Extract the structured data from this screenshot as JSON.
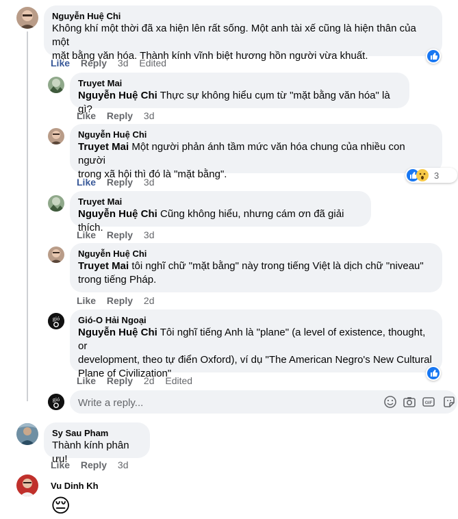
{
  "comments": [
    {
      "author": "Nguyễn Huệ Chi",
      "line1": "Không khí một thời đã xa hiện lên rất sống. Một anh tài xế cũng là hiện thân của một",
      "line2": "mặt bằng văn hóa. Thành kính vĩnh biệt hương hồn người vừa khuất.",
      "like": "Like",
      "reply": "Reply",
      "time": "3d",
      "edited": "Edited",
      "replies": [
        {
          "author": "Truyet Mai",
          "tag": "Nguyễn Huệ Chi",
          "text": " Thực sự không hiểu cụm từ \"mặt bằng văn hóa\" là gì?",
          "like": "Like",
          "reply": "Reply",
          "time": "3d"
        },
        {
          "author": "Nguyễn Huệ Chi",
          "tag": "Truyet Mai",
          "text": " Một người phản ánh tầm mức văn hóa chung của nhiều con người",
          "text2": "trong xã hội thì đó là \"mặt bằng\".",
          "like": "Like",
          "reply": "Reply",
          "time": "3d",
          "reaction_count": "3"
        },
        {
          "author": "Truyet Mai",
          "tag": "Nguyễn Huệ Chi",
          "text": " Cũng không hiểu, nhưng cám ơn đã giải thích.",
          "like": "Like",
          "reply": "Reply",
          "time": "3d"
        },
        {
          "author": "Nguyễn Huệ Chi",
          "tag": "Truyet Mai",
          "text": " tôi nghĩ chữ \"mặt bằng\" này trong tiếng Việt là dịch chữ \"niveau\"",
          "text2": "trong tiếng Pháp.",
          "like": "Like",
          "reply": "Reply",
          "time": "2d"
        },
        {
          "author": "Gió-O Hải Ngoại",
          "tag": "Nguyễn Huệ Chi",
          "text": " Tôi nghĩ tiếng Anh là \"plane\" (a level of existence, thought, or",
          "text2": "development, theo tự điển Oxford), ví dụ \"The American Negro's New Cultural",
          "text3": "Plane of Civilization\"",
          "like": "Like",
          "reply": "Reply",
          "time": "2d",
          "edited": "Edited"
        }
      ]
    },
    {
      "author": "Sy Sau Pham",
      "line1": "Thành kính phân ưu!",
      "like": "Like",
      "reply": "Reply",
      "time": "3d"
    },
    {
      "author": "Vu Dinh Kh",
      "emoji": "😔"
    }
  ],
  "reply_box": {
    "placeholder": "Write a reply..."
  },
  "avatar_text": {
    "gio_o": "gió"
  },
  "icons": [
    "like-reaction-icon",
    "wow-reaction-icon",
    "emoji-icon",
    "camera-icon",
    "gif-icon",
    "sticker-icon"
  ],
  "colors": {
    "bubble": "#f0f2f5",
    "meta": "#65676b",
    "like_blue": "#1877f2",
    "link": "#385898"
  }
}
